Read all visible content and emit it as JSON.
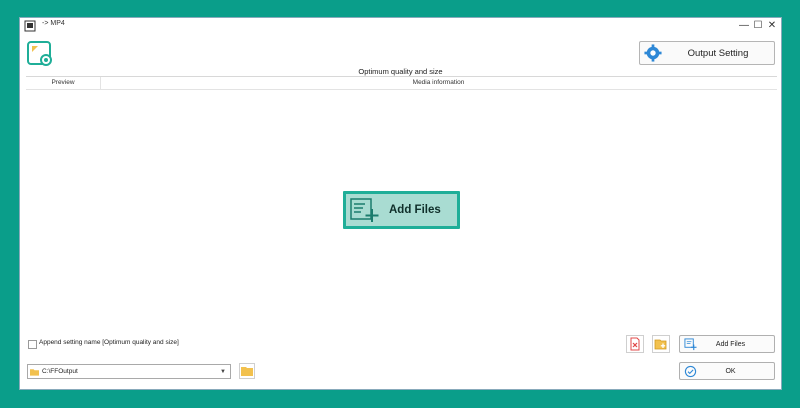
{
  "window": {
    "title": "-> MP4"
  },
  "toolbar": {
    "profile_text": "Optimum quality and size",
    "output_setting_label": "Output Setting"
  },
  "list": {
    "columns": [
      "Preview",
      "Media information"
    ],
    "center_add_label": "Add Files"
  },
  "bottom": {
    "append_label": "Append setting name [Optimum quality and size]",
    "add_files_label": "Add Files",
    "ok_label": "OK",
    "output_path": "C:\\FFOutput"
  },
  "colors": {
    "accent": "#1fae98",
    "background": "#0a9e8a",
    "folder": "#f2c14e",
    "delete": "#e04848"
  },
  "icons": [
    "app-icon",
    "logo-icon",
    "gear-icon",
    "add-files-icon",
    "delete-icon",
    "add-folder-icon",
    "folder-icon",
    "ok-icon"
  ]
}
